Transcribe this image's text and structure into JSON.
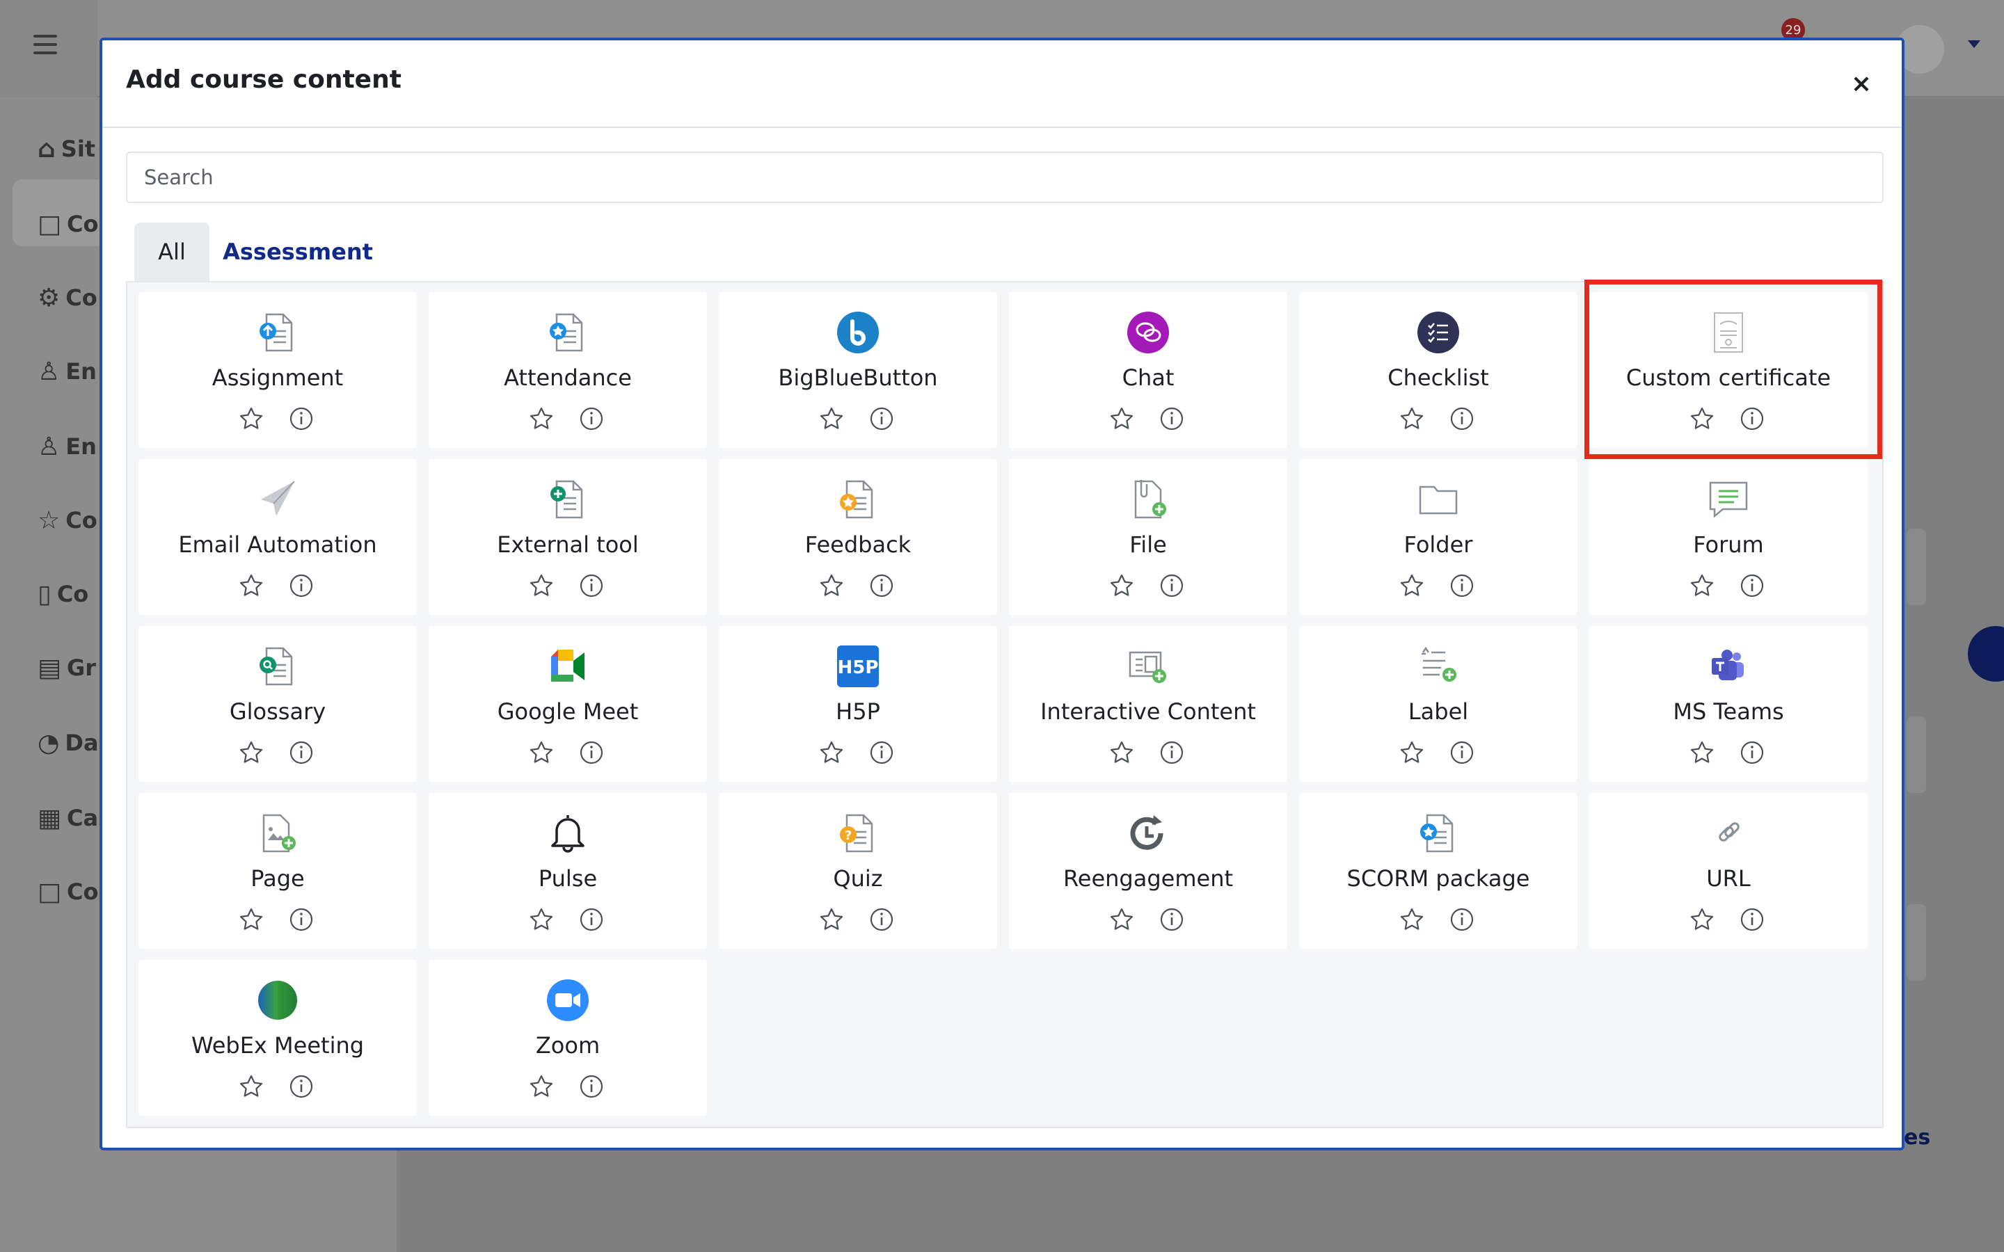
{
  "modal": {
    "title": "Add course content",
    "close_label": "×",
    "search_placeholder": "Search"
  },
  "tabs": [
    {
      "label": "All",
      "active": true
    },
    {
      "label": "Assessment",
      "active": false
    }
  ],
  "background": {
    "notification_count": "29",
    "sidebar_fragments": [
      "Sit",
      "Co",
      "Co",
      "En",
      "En",
      "Co",
      "Co",
      "Gr",
      "Da",
      "Ca",
      "Co"
    ],
    "link_fragment": "es"
  },
  "modules": [
    {
      "label": "Assignment",
      "icon": "assignment-icon"
    },
    {
      "label": "Attendance",
      "icon": "attendance-icon"
    },
    {
      "label": "BigBlueButton",
      "icon": "bigbluebutton-icon"
    },
    {
      "label": "Chat",
      "icon": "chat-icon"
    },
    {
      "label": "Checklist",
      "icon": "checklist-icon"
    },
    {
      "label": "Custom certificate",
      "icon": "certificate-icon"
    },
    {
      "label": "Email Automation",
      "icon": "paper-plane-icon"
    },
    {
      "label": "External tool",
      "icon": "external-tool-icon"
    },
    {
      "label": "Feedback",
      "icon": "feedback-icon"
    },
    {
      "label": "File",
      "icon": "file-icon"
    },
    {
      "label": "Folder",
      "icon": "folder-icon"
    },
    {
      "label": "Forum",
      "icon": "forum-icon"
    },
    {
      "label": "Glossary",
      "icon": "glossary-icon"
    },
    {
      "label": "Google Meet",
      "icon": "google-meet-icon"
    },
    {
      "label": "H5P",
      "icon": "h5p-icon"
    },
    {
      "label": "Interactive Content",
      "icon": "interactive-content-icon"
    },
    {
      "label": "Label",
      "icon": "label-icon"
    },
    {
      "label": "MS Teams",
      "icon": "ms-teams-icon"
    },
    {
      "label": "Page",
      "icon": "page-icon"
    },
    {
      "label": "Pulse",
      "icon": "bell-icon"
    },
    {
      "label": "Quiz",
      "icon": "quiz-icon"
    },
    {
      "label": "Reengagement",
      "icon": "reengagement-icon"
    },
    {
      "label": "SCORM package",
      "icon": "scorm-icon"
    },
    {
      "label": "URL",
      "icon": "link-icon"
    },
    {
      "label": "WebEx Meeting",
      "icon": "webex-icon"
    },
    {
      "label": "Zoom",
      "icon": "zoom-icon"
    }
  ],
  "highlighted_module": "Custom certificate",
  "colors": {
    "modal_border": "#1f4fb0",
    "highlight": "#e8291c",
    "tab_active_bg": "#e9ecef",
    "tab_link": "#0f2a8a"
  }
}
